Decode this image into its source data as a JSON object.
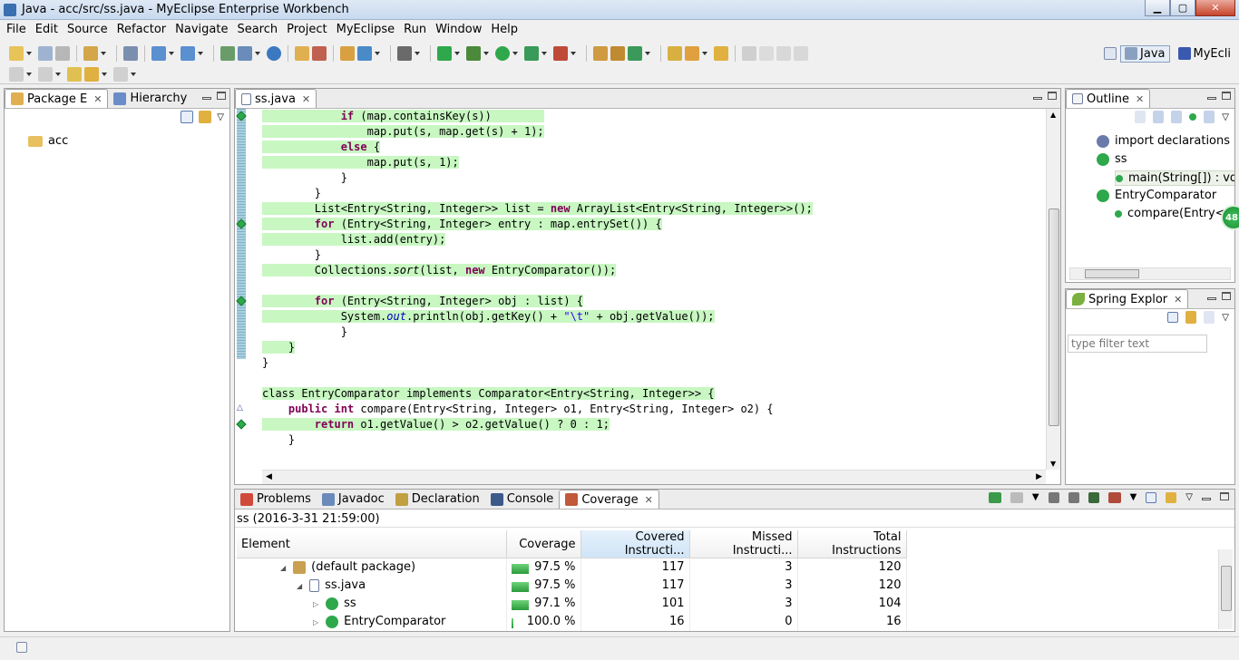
{
  "window": {
    "title": "Java - acc/src/ss.java - MyEclipse Enterprise Workbench",
    "minimize": "▁",
    "maximize": "▢",
    "close": "✕"
  },
  "menu": [
    "File",
    "Edit",
    "Source",
    "Refactor",
    "Navigate",
    "Search",
    "Project",
    "MyEclipse",
    "Run",
    "Window",
    "Help"
  ],
  "perspectives": [
    {
      "label": "Java",
      "active": true
    },
    {
      "label": "MyEcli",
      "active": false
    }
  ],
  "left_panel": {
    "tabs": [
      {
        "label": "Package E",
        "active": true
      },
      {
        "label": "Hierarchy",
        "active": false
      }
    ],
    "tree": [
      {
        "label": "acc",
        "icon": "project-folder-icon"
      }
    ]
  },
  "editor": {
    "tab": "ss.java",
    "lines": [
      {
        "html": "<span class='hl'>            <span class='kw'>if</span> (map.containsKey(s))        </span>",
        "marker": "diamond"
      },
      {
        "html": "<span class='hl'>                map.put(s, map.get(s) + 1);</span>"
      },
      {
        "html": "<span class='hl'>            <span class='kw'>else</span> {</span>"
      },
      {
        "html": "<span class='hl'>                map.put(s, 1);</span>"
      },
      {
        "html": "            }"
      },
      {
        "html": "        }"
      },
      {
        "html": "<span class='hl'>        List&lt;Entry&lt;String, Integer&gt;&gt; list = <span class='kw'>new</span> ArrayList&lt;Entry&lt;String, Integer&gt;&gt;();</span>"
      },
      {
        "html": "<span class='hl'>        <span class='kw'>for</span> (Entry&lt;String, Integer&gt; entry : map.entrySet()) {</span>",
        "marker": "diamond"
      },
      {
        "html": "<span class='hl'>            list.add(entry);</span>"
      },
      {
        "html": "        }"
      },
      {
        "html": "<span class='hl'>        Collections.<span class='ital'>sort</span>(list, <span class='kw'>new</span> EntryComparator());</span>"
      },
      {
        "html": ""
      },
      {
        "html": "<span class='hl'>        <span class='kw'>for</span> (Entry&lt;String, Integer&gt; obj : list) {</span>",
        "marker": "diamond"
      },
      {
        "html": "<span class='hl'>            System.<span class='fld'>out</span>.println(obj.getKey() + <span class='str'>\"\\t\"</span> + obj.getValue());</span>"
      },
      {
        "html": "            }"
      },
      {
        "html": "<span class='hl'>    }</span>"
      },
      {
        "html": "}"
      },
      {
        "html": ""
      },
      {
        "html": "<span class='hl'>class EntryComparator implements Comparator&lt;Entry&lt;String, Integer&gt;&gt; {</span>"
      },
      {
        "html": "    <span class='kw'>public</span> <span class='kw'>int</span> compare(Entry&lt;String, Integer&gt; o1, Entry&lt;String, Integer&gt; o2) {",
        "marker": "override"
      },
      {
        "html": "<span class='hl'>        <span class='kw'>return</span> o1.getValue() &gt; o2.getValue() ? 0 : 1;</span>",
        "marker": "diamond"
      },
      {
        "html": "    }"
      }
    ]
  },
  "outline": {
    "tab": "Outline",
    "items": [
      {
        "label": "import declarations",
        "indent": 0
      },
      {
        "label": "ss",
        "indent": 0
      },
      {
        "label": "main(String[]) : vo",
        "indent": 1
      },
      {
        "label": "EntryComparator",
        "indent": 0
      },
      {
        "label": "compare(Entry<",
        "indent": 1
      }
    ],
    "badge": "48"
  },
  "spring": {
    "tab": "Spring Explor",
    "filter_placeholder": "type filter text"
  },
  "bottom": {
    "tabs": [
      {
        "label": "Problems",
        "active": false
      },
      {
        "label": "Javadoc",
        "active": false
      },
      {
        "label": "Declaration",
        "active": false
      },
      {
        "label": "Console",
        "active": false
      },
      {
        "label": "Coverage",
        "active": true
      }
    ],
    "session": "ss (2016-3-31 21:59:00)",
    "columns": [
      "Element",
      "Coverage",
      "Covered Instructi...",
      "Missed Instructi...",
      "Total Instructions"
    ],
    "rows": [
      {
        "indent": 1,
        "arrow": "◢",
        "icon": "package-icon",
        "element": "(default package)",
        "coverage": "97.5 %",
        "pct": 97.5,
        "covered": "117",
        "missed": "3",
        "total": "120"
      },
      {
        "indent": 2,
        "arrow": "◢",
        "icon": "java-file-icon",
        "element": "ss.java",
        "coverage": "97.5 %",
        "pct": 97.5,
        "covered": "117",
        "missed": "3",
        "total": "120"
      },
      {
        "indent": 3,
        "arrow": "▷",
        "icon": "class-icon",
        "element": "ss",
        "coverage": "97.1 %",
        "pct": 97.1,
        "covered": "101",
        "missed": "3",
        "total": "104"
      },
      {
        "indent": 3,
        "arrow": "▷",
        "icon": "class-icon",
        "element": "EntryComparator",
        "coverage": "100.0 %",
        "pct": 100.0,
        "covered": "16",
        "missed": "0",
        "total": "16"
      }
    ]
  }
}
